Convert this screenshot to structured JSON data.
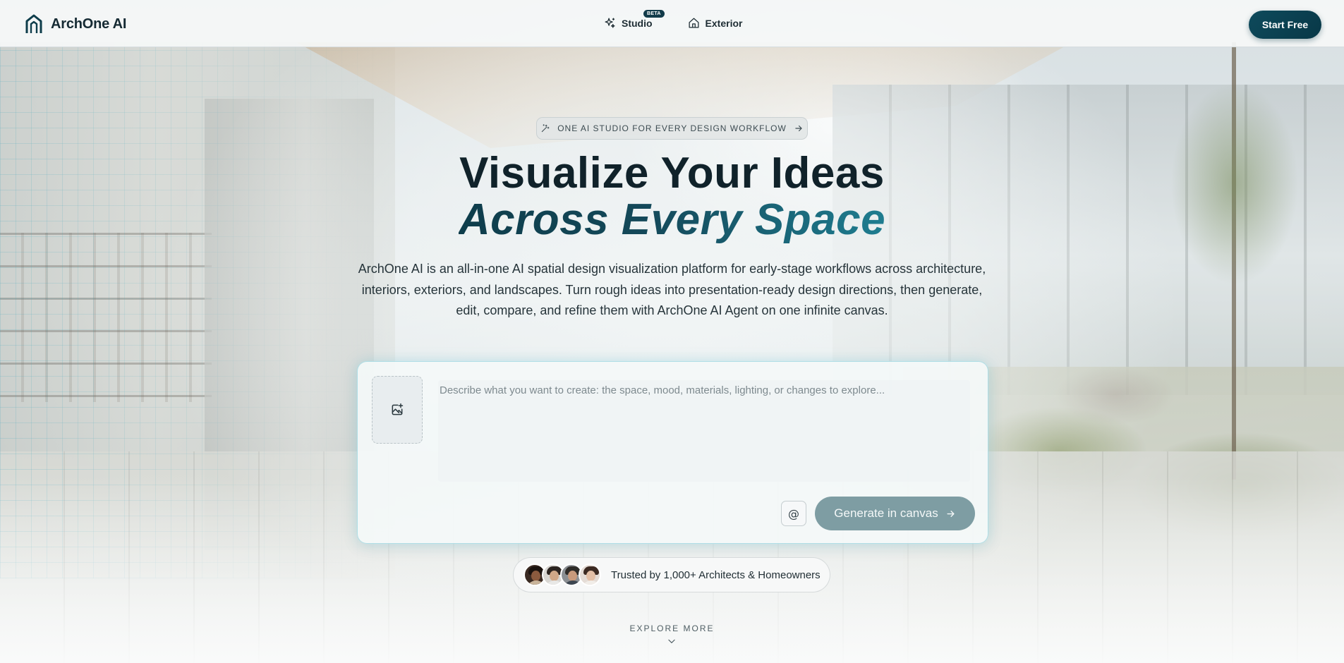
{
  "nav": {
    "brand": "ArchOne AI",
    "links": [
      {
        "label": "Studio",
        "icon": "sparkles-icon",
        "badge": "BETA"
      },
      {
        "label": "Exterior",
        "icon": "home-icon"
      }
    ],
    "cta": "Start Free"
  },
  "hero": {
    "pill": "ONE AI STUDIO FOR EVERY DESIGN WORKFLOW",
    "title_line1": "Visualize Your Ideas",
    "title_line2": "Across Every Space",
    "subtitle": "ArchOne AI is an all-in-one AI spatial design visualization platform for early-stage workflows across architecture, interiors, exteriors, and landscapes. Turn rough ideas into presentation-ready design directions, then generate, edit, compare, and refine them with ArchOne AI Agent on one infinite canvas."
  },
  "composer": {
    "placeholder": "Describe what you want to create: the space, mood, materials, lighting, or changes to explore...",
    "mention_label": "@",
    "generate_label": "Generate in canvas"
  },
  "trusted": {
    "text": "Trusted by 1,000+ Architects & Homeowners"
  },
  "explore": {
    "label": "EXPLORE MORE"
  },
  "colors": {
    "brand_dark": "#083847",
    "accent_teal": "#1f7d90",
    "generate_disabled": "#7e9da3"
  }
}
